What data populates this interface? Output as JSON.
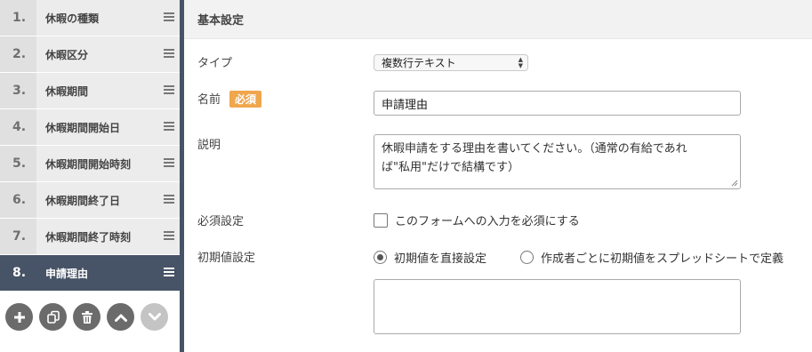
{
  "sidebar": {
    "items": [
      {
        "num": "1.",
        "label": "休暇の種類"
      },
      {
        "num": "2.",
        "label": "休暇区分"
      },
      {
        "num": "3.",
        "label": "休暇期間"
      },
      {
        "num": "4.",
        "label": "休暇期間開始日"
      },
      {
        "num": "5.",
        "label": "休暇期間開始時刻"
      },
      {
        "num": "6.",
        "label": "休暇期間終了日"
      },
      {
        "num": "7.",
        "label": "休暇期間終了時刻"
      },
      {
        "num": "8.",
        "label": "申請理由"
      }
    ],
    "active_index": 7,
    "actions": [
      {
        "icon": "plus-icon",
        "enabled": true
      },
      {
        "icon": "copy-icon",
        "enabled": true
      },
      {
        "icon": "trash-icon",
        "enabled": true
      },
      {
        "icon": "chevron-up-icon",
        "enabled": true
      },
      {
        "icon": "chevron-down-icon",
        "enabled": false
      }
    ]
  },
  "panel": {
    "title": "基本設定",
    "type": {
      "label": "タイプ",
      "value": "複数行テキスト"
    },
    "name": {
      "label": "名前",
      "badge": "必須",
      "value": "申請理由"
    },
    "description": {
      "label": "説明",
      "line1": "休暇申請をする理由を書いてください。（通常の有給であれ",
      "line2": "ば\"私用\"だけで結構です）"
    },
    "required": {
      "label": "必須設定",
      "checkbox_label": "このフォームへの入力を必須にする",
      "checked": false
    },
    "initial": {
      "label": "初期値設定",
      "option1": "初期値を直接設定",
      "option2": "作成者ごとに初期値をスプレッドシートで定義",
      "selected": "option1",
      "value": ""
    }
  },
  "colors": {
    "active": "#475366",
    "badge": "#f0a64c"
  }
}
